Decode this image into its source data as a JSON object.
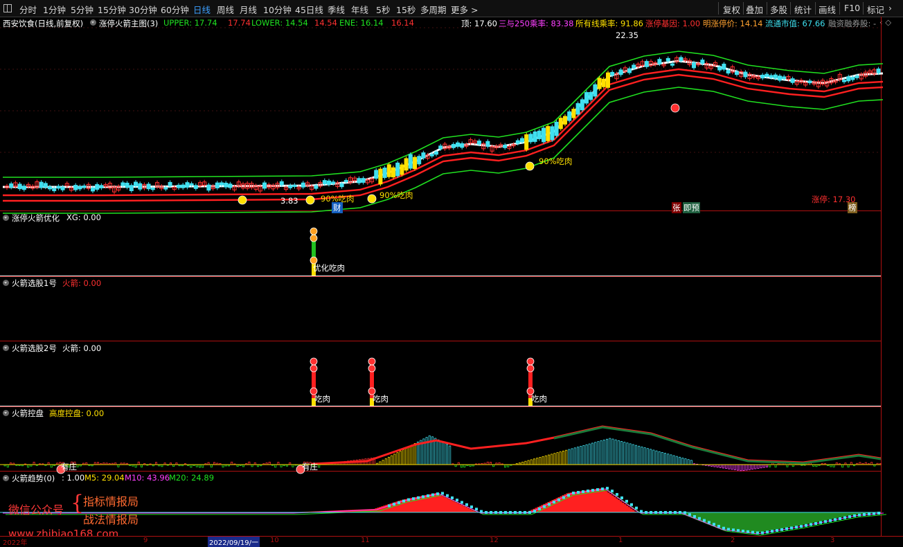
{
  "toolbar": {
    "periods": [
      "分时",
      "1分钟",
      "5分钟",
      "15分钟",
      "30分钟",
      "60分钟",
      "日线",
      "周线",
      "月线",
      "10分钟",
      "45日线",
      "季线",
      "年线",
      "5秒",
      "15秒",
      "多周期",
      "更多 >"
    ],
    "active": "日线",
    "right_buttons": [
      "复权",
      "叠加",
      "多股",
      "统计",
      "画线",
      "F10",
      "标记"
    ]
  },
  "main_panel": {
    "stock_name": "西安饮食(日线,前复权)",
    "indicator_name": "涨停火箭主图(3)",
    "upper_label": "UPPER: 17.74",
    "upper_value": "17.74",
    "lower_label": "LOWER: 14.54",
    "lower_value": "14.54",
    "ene_label": "ENE: 16.14",
    "ene_value": "16.14",
    "top_value": "顶: 17.60",
    "ma_ratio": "三与250乘率: 83.38",
    "all_ratio": "所有线乘率: 91.86",
    "zt_gene": "涨停基因: 1.00",
    "next_zt": "明涨停价: 14.14",
    "float_mv": "流通市值: 67.66",
    "margin": "融资融券股: -",
    "high_mark": "22.35",
    "low_mark": "3.83",
    "zt_price": "涨停: 17.30",
    "annot_eat": [
      "90%吃肉",
      "90%吃肉",
      "90%吃肉"
    ],
    "badge_cai": "财",
    "badge_zhang": "张",
    "badge_yu": "即预",
    "badge_bang": "榜"
  },
  "panel2": {
    "title": "涨停火箭优化",
    "value": "XG: 0.00",
    "annot": "优化吃肉"
  },
  "panel3": {
    "title": "火箭选股1号",
    "value": "火箭: 0.00"
  },
  "panel4": {
    "title": "火箭选股2号",
    "value": "火箭: 0.00",
    "annot": [
      "吃肉",
      "吃肉",
      "吃肉"
    ]
  },
  "panel5": {
    "title": "火箭控盘",
    "value": "高度控盘: 0.00",
    "annot": [
      "有庄",
      "有庄"
    ]
  },
  "panel6": {
    "title": "火箭趋势(0)",
    "v1": ": 1.00",
    "m5": "M5: 29.04",
    "m10": "M10: 43.96",
    "m20": "M20: 24.89"
  },
  "watermark": {
    "account": "微信公众号",
    "brace": "{",
    "line1": "指标情报局",
    "line2": "战法情报局",
    "url": "www.zhibiao168.com"
  },
  "time_axis": {
    "labels": [
      "2022年",
      "9",
      "2022/09/19/一",
      "10",
      "11",
      "12",
      "1",
      "2",
      "3"
    ]
  },
  "colors": {
    "up": "#ff3030",
    "down": "#40e0f0",
    "upper": "#ff2020",
    "lower": "#20e020",
    "ene": "#ffffff",
    "yellow": "#ffe000"
  }
}
